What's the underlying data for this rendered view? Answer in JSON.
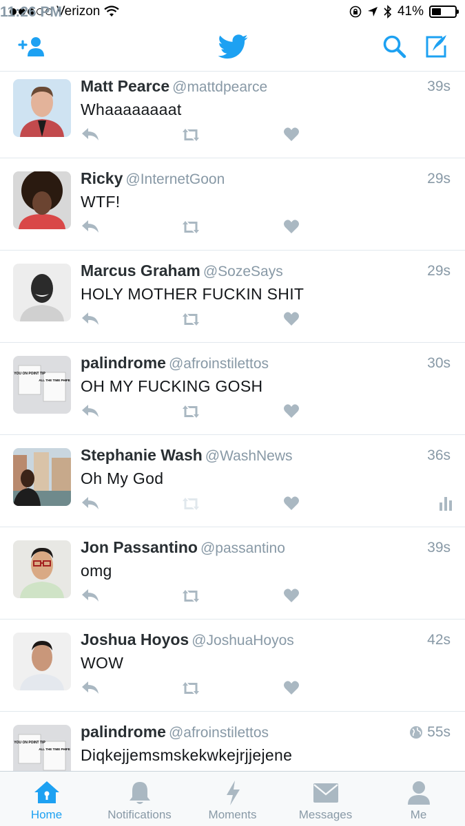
{
  "status_bar": {
    "carrier": "Verizon",
    "signal_bars_filled": 3,
    "signal_bars_total": 5,
    "time": "11:26 PM",
    "battery_percent": "41%",
    "battery_level": 0.41
  },
  "nav": {
    "icons": [
      "add-user-icon",
      "twitter-bird-icon",
      "search-icon",
      "compose-icon"
    ]
  },
  "tweets": [
    {
      "name": "Matt Pearce",
      "handle": "@mattdpearce",
      "time": "39s",
      "text": "Whaaaaaaaat"
    },
    {
      "name": "Ricky",
      "handle": "@InternetGoon",
      "time": "29s",
      "text": "WTF!"
    },
    {
      "name": "Marcus Graham",
      "handle": "@SozeSays",
      "time": "29s",
      "text": "HOLY MOTHER FUCKIN SHIT"
    },
    {
      "name": "palindrome",
      "handle": "@afroinstilettos",
      "time": "30s",
      "text": "OH MY FUCKING GOSH"
    },
    {
      "name": "Stephanie Wash",
      "handle": "@WashNews",
      "time": "36s",
      "text": "Oh My God"
    },
    {
      "name": "Jon Passantino",
      "handle": "@passantino",
      "time": "39s",
      "text": "omg"
    },
    {
      "name": "Joshua Hoyos",
      "handle": "@JoshuaHoyos",
      "time": "42s",
      "text": "WOW"
    },
    {
      "name": "palindrome",
      "handle": "@afroinstilettos",
      "time": "55s",
      "text": "Diqkejjemsmskekwkejrjjejene"
    }
  ],
  "avatar_art": {
    "poster_text_1": "YOU ON POINT TIP",
    "poster_text_2": "ALL THE TIME PHIFE"
  },
  "tabs": [
    {
      "label": "Home",
      "active": true
    },
    {
      "label": "Notifications",
      "active": false
    },
    {
      "label": "Moments",
      "active": false
    },
    {
      "label": "Messages",
      "active": false
    },
    {
      "label": "Me",
      "active": false
    }
  ],
  "colors": {
    "accent": "#1da1f2",
    "muted": "#8899a6",
    "action_icon": "#aab8c2"
  }
}
